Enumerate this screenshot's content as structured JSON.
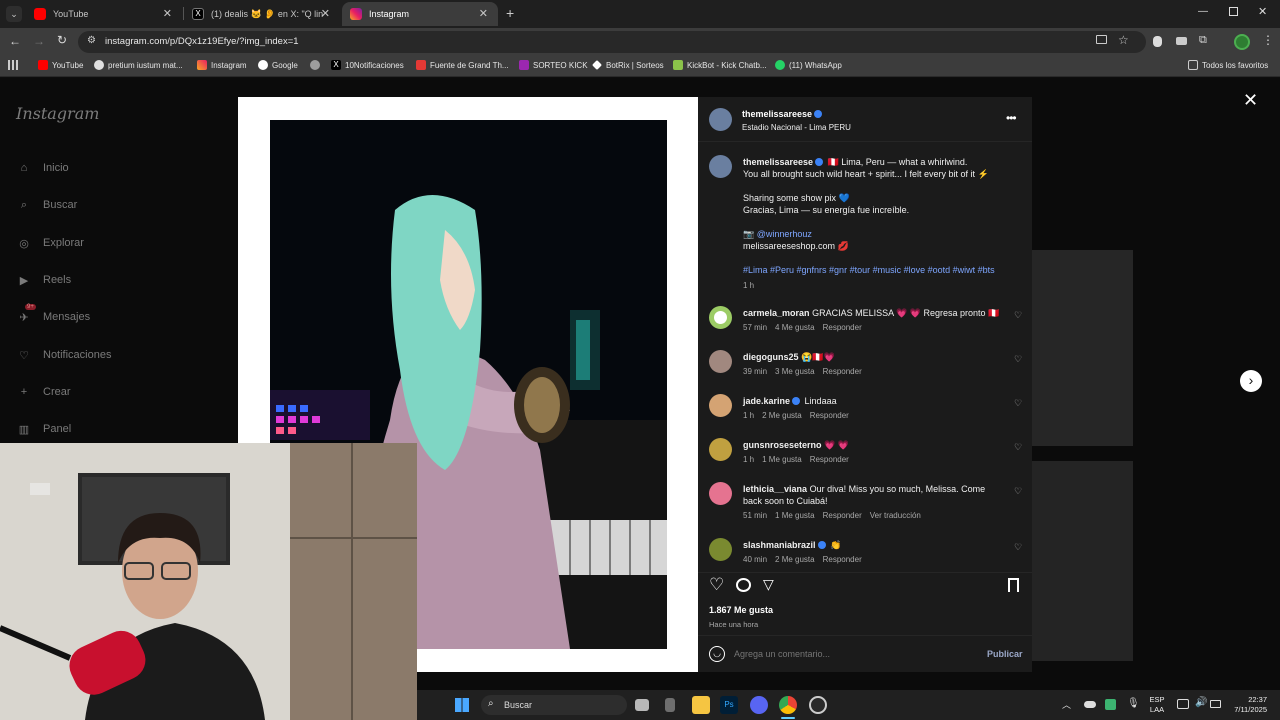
{
  "browser": {
    "tabs": [
      {
        "label": "YouTube",
        "active": false
      },
      {
        "label": "(1) dealis 🐱 👂 en X: \"Q lindo",
        "active": false
      },
      {
        "label": "Instagram",
        "active": true
      }
    ],
    "url": "instagram.com/p/DQx1z19Efye/?img_index=1",
    "bookmarks": [
      "YouTube",
      "pretium iustum mat...",
      "Instagram",
      "Google",
      "",
      "10Notificaciones",
      "Fuente de Grand Th...",
      "SORTEO KICK",
      "BotRix | Sorteos",
      "KickBot - Kick Chatb...",
      "(11) WhatsApp"
    ],
    "all_bookmarks": "Todos los favoritos"
  },
  "sidebar": {
    "logo": "Instagram",
    "items": [
      {
        "label": "Inicio",
        "icon": "home-icon"
      },
      {
        "label": "Buscar",
        "icon": "search-icon"
      },
      {
        "label": "Explorar",
        "icon": "compass-icon"
      },
      {
        "label": "Reels",
        "icon": "reels-icon"
      },
      {
        "label": "Mensajes",
        "icon": "messages-icon",
        "badge": "9+"
      },
      {
        "label": "Notificaciones",
        "icon": "heart-icon"
      },
      {
        "label": "Crear",
        "icon": "plus-icon"
      },
      {
        "label": "Panel",
        "icon": "dashboard-icon"
      }
    ]
  },
  "post": {
    "author": "themelissareese",
    "location": "Estadio Nacional - Lima PERU",
    "caption_author": "themelissareese",
    "caption_line1": "🇵🇪 Lima, Peru — what a whirlwind.",
    "caption_line2": "You all brought such wild heart + spirit... I felt every bit of it ⚡",
    "caption_line3": "Sharing some show pix 💙",
    "caption_line4": "Gracias, Lima — su energía fue increíble.",
    "caption_mention": "📷 @winnerhouz",
    "caption_shop": "melissareeseshop.com 💋",
    "hashtags": "#Lima #Peru #gnfnrs #gnr #tour #music #love #ootd #wiwt #bts",
    "caption_time": "1 h",
    "likes": "1.867 Me gusta",
    "posted": "Hace una hora",
    "comment_placeholder": "Agrega un comentario...",
    "publish": "Publicar"
  },
  "comments": [
    {
      "user": "carmela_moran",
      "text": "GRACIAS MELISSA 💗 💗 Regresa pronto 🇵🇪",
      "time": "57 min",
      "likes": "4 Me gusta",
      "reply": "Responder",
      "avatar_color": "#9ccc65",
      "verified": false
    },
    {
      "user": "diegoguns25",
      "text": "😭🇵🇪💗",
      "time": "39 min",
      "likes": "3 Me gusta",
      "reply": "Responder",
      "avatar_color": "#a1887f",
      "verified": false
    },
    {
      "user": "jade.karine",
      "text": "Lindaaa",
      "time": "1 h",
      "likes": "2 Me gusta",
      "reply": "Responder",
      "avatar_color": "#d4a373",
      "verified": true
    },
    {
      "user": "gunsnroseseterno",
      "text": "💗 💗",
      "time": "1 h",
      "likes": "1 Me gusta",
      "reply": "Responder",
      "avatar_color": "#c0a040",
      "verified": false
    },
    {
      "user": "lethicia__viana",
      "text": "Our diva! Miss you so much, Melissa. Come",
      "text2": "back soon to Cuiabá!",
      "time": "51 min",
      "likes": "1 Me gusta",
      "reply": "Responder",
      "translate": "Ver traducción",
      "avatar_color": "#e57390",
      "verified": false
    },
    {
      "user": "slashmaniabrazil",
      "text": "👏",
      "time": "40 min",
      "likes": "2 Me gusta",
      "reply": "Responder",
      "avatar_color": "#7a8a30",
      "verified": true
    }
  ],
  "taskbar": {
    "search": "Buscar",
    "lang1": "ESP",
    "lang2": "LAA",
    "time": "22:37",
    "date": "7/11/2025"
  }
}
